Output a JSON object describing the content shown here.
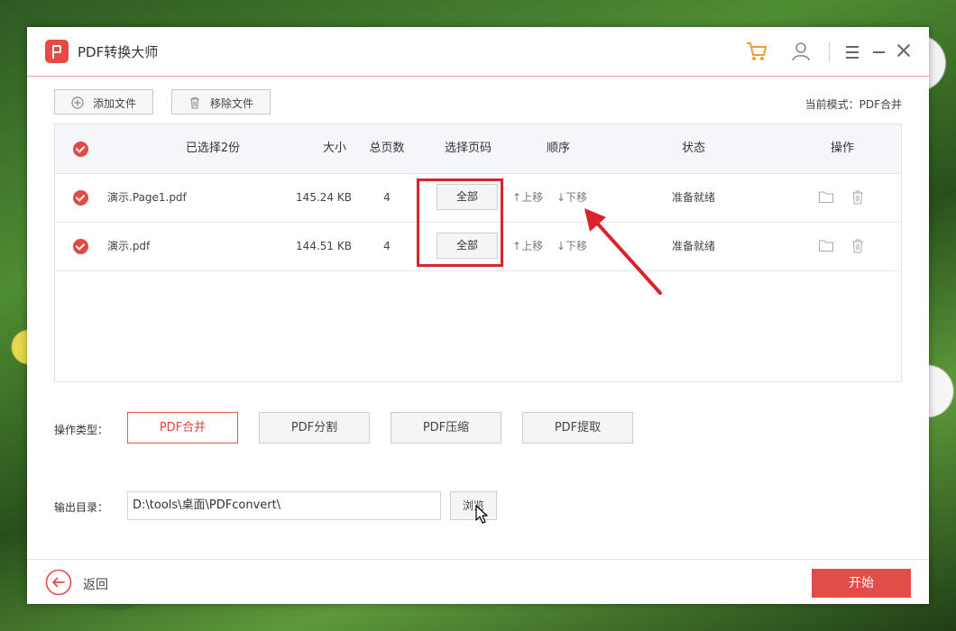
{
  "app": {
    "title": "PDF转换大师"
  },
  "toolbar": {
    "add_label": "添加文件",
    "remove_label": "移除文件",
    "mode_text": "当前模式：PDF合并"
  },
  "table": {
    "headers": {
      "selected": "已选择2份",
      "size": "大小",
      "pages": "总页数",
      "page_select": "选择页码",
      "order": "顺序",
      "status": "状态",
      "action": "操作"
    },
    "rows": [
      {
        "name": "演示.Page1.pdf",
        "size": "145.24 KB",
        "pages": "4",
        "page_select": "全部",
        "up": "上移",
        "down": "下移",
        "status": "准备就绪"
      },
      {
        "name": "演示.pdf",
        "size": "144.51 KB",
        "pages": "4",
        "page_select": "全部",
        "up": "上移",
        "down": "下移",
        "status": "准备就绪"
      }
    ]
  },
  "operation": {
    "label": "操作类型：",
    "types": [
      "PDF合并",
      "PDF分割",
      "PDF压缩",
      "PDF提取"
    ],
    "active": "PDF合并"
  },
  "output": {
    "label": "输出目录：",
    "path": "D:\\tools\\桌面\\PDFconvert\\",
    "browse_label": "浏览"
  },
  "footer": {
    "back_label": "返回",
    "start_label": "开始"
  },
  "colors": {
    "accent": "#e24d4a",
    "annotation": "#d9252a"
  }
}
